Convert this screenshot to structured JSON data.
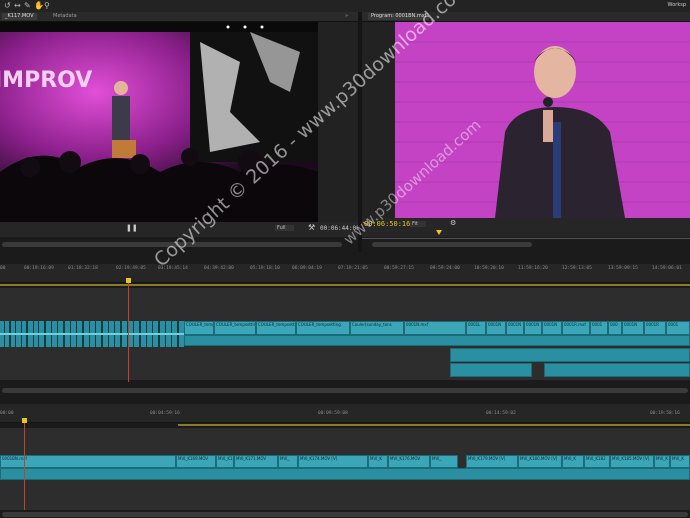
{
  "app": {
    "workspace_label": "Worksp"
  },
  "source_monitor": {
    "tabs": [
      "_K117.MOV",
      "Metadata"
    ],
    "expand_label": "»",
    "timecode": "00:06:44:00",
    "fit_label": "Full"
  },
  "program_monitor": {
    "tabs": [
      "Program: 0001BN.mxf"
    ],
    "timecode": "00:06:50:16",
    "fit_label": "Fit"
  },
  "timeline_upper": {
    "ruler_ticks": [
      "00",
      "00:19:16:09",
      "01:18:32:18",
      "02:19:49:05",
      "03:19:45:14",
      "04:39:42:00",
      "05:19:18:10",
      "06:09:04:19",
      "07:19:21:05",
      "08:59:27:15",
      "09:59:24:00",
      "10:59:20:10",
      "11:59:16:20",
      "12:59:13:05",
      "13:59:09:15",
      "14:59:06:01"
    ],
    "clip_labels": [
      "COULER_tempsetting",
      "COULER_tempsetting",
      "COULER_tempsettings2",
      "COULER_tempsetting",
      "Couler(sunday_tons",
      "0001N.mxf",
      "0001L",
      "0001N",
      "0001N",
      "0001N",
      "0001N",
      "0001R.mxf",
      "0001",
      "000",
      "0001N",
      "0001R",
      "0001"
    ]
  },
  "timeline_lower": {
    "ruler_ticks": [
      "00:00",
      "00:04:59:16",
      "00:09:59:08",
      "00:14:59:02",
      "00:19:58:16"
    ],
    "clip_labels": [
      "0001BN.mxf",
      "MVI_K169.MOV",
      "MVI_K1",
      "MVI_K171.MOV",
      "MVI_",
      "MVI_K174.MOV [V]",
      "MVI_K",
      "MVI_K176.MOV",
      "MVI_",
      "MVI_K179.MOV [V]",
      "MVI_K180.MOV [V]",
      "MVI_K",
      "MVI_K182",
      "MVI_K185.MOV [V]",
      "MVI_K",
      "MVI_K"
    ]
  },
  "watermark": {
    "line1": "Copyright © 2016 - www.p30download.com",
    "line2": "www.p30download.com"
  },
  "colors": {
    "clip": "#3aa6b8",
    "timecode": "#e6c620",
    "playhead": "#c9402a"
  }
}
